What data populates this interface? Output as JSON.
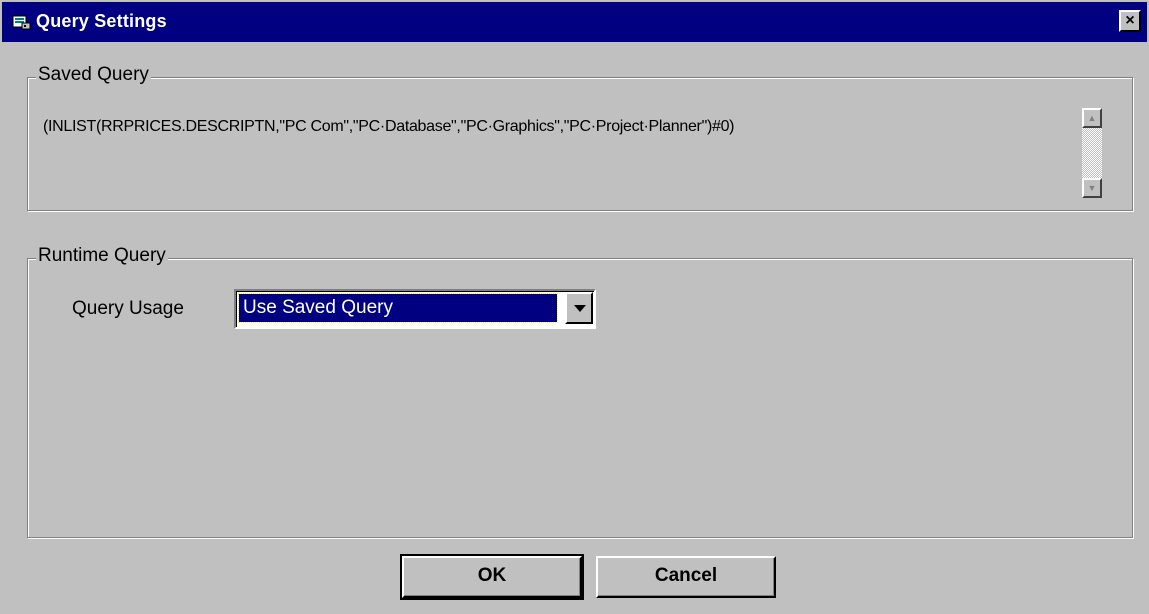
{
  "window": {
    "title": "Query Settings",
    "close_label": "×",
    "title_bar_color": "#000080"
  },
  "saved_query": {
    "group_label": "Saved Query",
    "text": "(INLIST(RRPRICES.DESCRIPTN,\"PC Com\",\"PC·Database\",\"PC·Graphics\",\"PC·Project·Planner\")#0)",
    "scroll_up_icon": "scroll-up-arrow-icon",
    "scroll_down_icon": "scroll-down-arrow-icon"
  },
  "runtime_query": {
    "group_label": "Runtime Query",
    "usage_label": "Query Usage",
    "usage_value": "Use Saved Query"
  },
  "buttons": {
    "ok_label": "OK",
    "cancel_label": "Cancel"
  }
}
